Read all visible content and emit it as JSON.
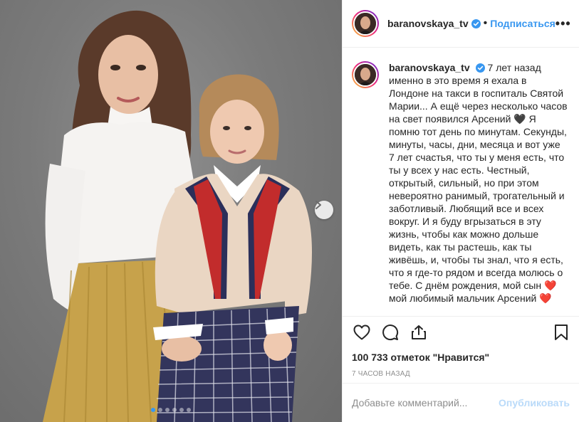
{
  "post": {
    "username": "baranovskaya_tv",
    "follow_label": "Подписаться",
    "dot_separator": "•",
    "more_label": "•••",
    "caption": "7 лет назад именно в это время я ехала в Лондоне на такси в госпиталь Святой Марии... А ещё через несколько часов на свет появился Арсений 🖤 Я помню тот день по минутам. Секунды, минуты, часы, дни, месяца и вот уже 7 лет счастья, что ты у меня есть, что ты у всех у нас есть. Честный, открытый, сильный, но при этом невероятно ранимый, трогательный и заботливый. Любящий все и всех вокруг. И я буду вгрызаться в эту жизнь, чтобы как можно дольше видеть, как ты растешь, как ты живёшь, и, чтобы ты знал, что я есть, что я где-то рядом и всегда молюсь о тебе. С днём рождения, мой сын ❤️ мой любимый мальчик Арсений ❤️",
    "likes": "100 733 отметок \"Нравится\"",
    "time_ago": "7 ЧАСОВ НАЗАД",
    "comment_placeholder": "Добавьте комментарий...",
    "publish_label": "Опубликовать"
  },
  "carousel": {
    "dot_count": 6,
    "active_index": 0
  },
  "icons": {
    "verified": "verified-badge-icon",
    "like": "heart-icon",
    "comment": "comment-icon",
    "share": "share-icon",
    "save": "bookmark-icon",
    "next": "chevron-right-icon"
  },
  "colors": {
    "accent": "#3897f0",
    "text": "#262626",
    "muted": "#8e8e8e",
    "border": "#efefef"
  }
}
